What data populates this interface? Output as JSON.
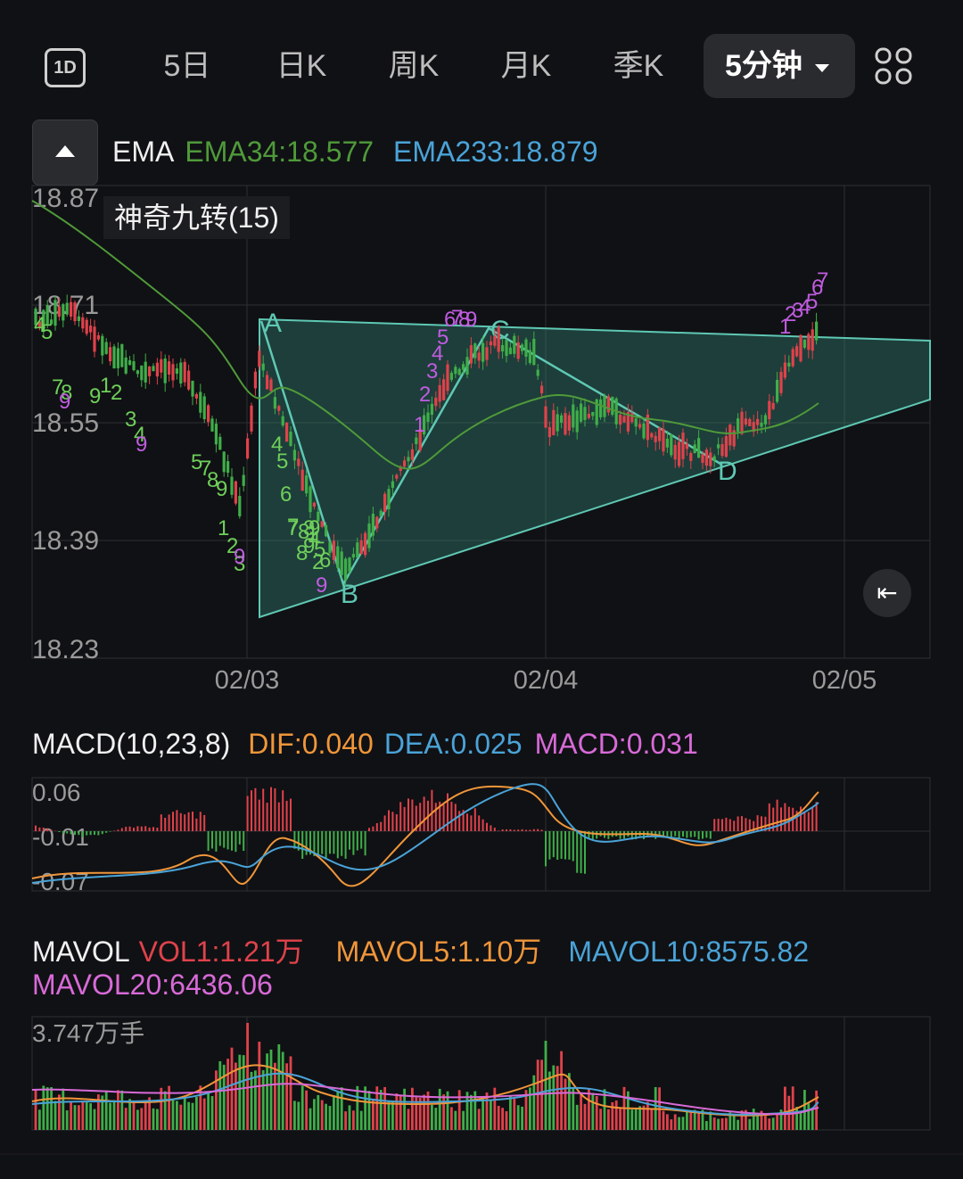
{
  "toolbar": {
    "icon_1d": "1D",
    "tabs": [
      "5日",
      "日K",
      "周K",
      "月K",
      "季K"
    ],
    "active_tab": "5分钟",
    "grid_icon": "grid-icon"
  },
  "ema_legend": {
    "name": "EMA",
    "ema34": "EMA34:18.577",
    "ema233": "EMA233:18.879",
    "colors": {
      "ema34": "#4f9a3a",
      "ema233": "#4aa3d8"
    }
  },
  "indicator_label": "神奇九转(15)",
  "main_chart": {
    "y_ticks": [
      "18.87",
      "18.71",
      "18.55",
      "18.39",
      "18.23"
    ],
    "x_ticks": [
      "02/03",
      "02/04",
      "02/05"
    ],
    "pattern_points": [
      "A",
      "B",
      "C",
      "D"
    ],
    "colors": {
      "up": "#e0424b",
      "down": "#3fae49",
      "triangle": "#5fc8b4"
    },
    "nine_turn_green": [
      "4",
      "5",
      "7",
      "8",
      "9",
      "1",
      "2",
      "3",
      "4",
      "5",
      "7",
      "8",
      "9",
      "1",
      "2",
      "3",
      "4",
      "5",
      "6",
      "7",
      "8",
      "9",
      "1",
      "2",
      "3",
      "4",
      "5",
      "6",
      "7",
      "8",
      "9"
    ],
    "nine_turn_purple": [
      "1",
      "2",
      "3",
      "4",
      "5",
      "6",
      "7",
      "8",
      "9",
      "1",
      "2",
      "3",
      "4",
      "5",
      "6",
      "7"
    ]
  },
  "macd_legend": {
    "name": "MACD(10,23,8)",
    "dif": "DIF:0.040",
    "dea": "DEA:0.025",
    "macd": "MACD:0.031",
    "colors": {
      "dif": "#f0963a",
      "dea": "#4aa3d8",
      "macd": "#d86ad8"
    }
  },
  "macd_chart": {
    "y_ticks": [
      "0.06",
      "-0.01",
      "-0.07"
    ]
  },
  "vol_legend": {
    "name": "MAVOL",
    "vol1": "VOL1:1.21万",
    "mavol5": "MAVOL5:1.10万",
    "mavol10": "MAVOL10:8575.82",
    "mavol20": "MAVOL20:6436.06",
    "colors": {
      "vol1": "#e0424b",
      "mavol5": "#f0963a",
      "mavol10": "#4aa3d8",
      "mavol20": "#d86ad8"
    }
  },
  "vol_chart": {
    "y_max": "3.747万手"
  },
  "back_icon": "collapse-to-latest-icon"
}
